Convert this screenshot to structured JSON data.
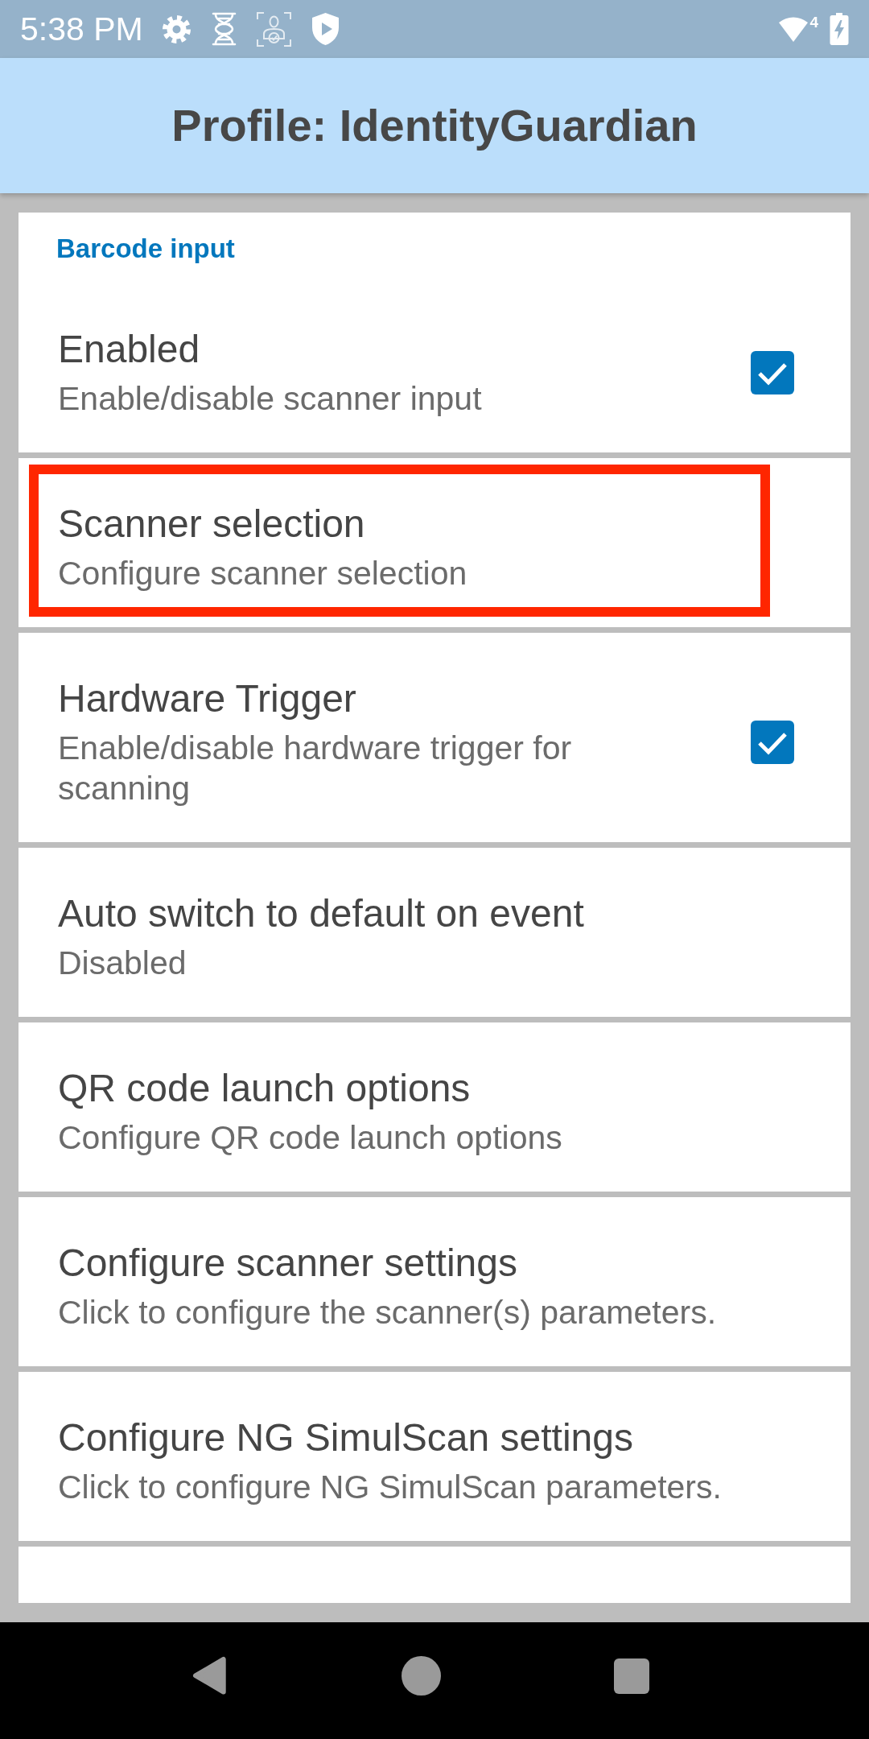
{
  "status_bar": {
    "time": "5:38 PM",
    "network_badge": "4"
  },
  "app_bar": {
    "title": "Profile: IdentityGuardian"
  },
  "section": {
    "title": "Barcode input",
    "items": [
      {
        "kind": "checkbox",
        "title": "Enabled",
        "summary": "Enable/disable scanner input",
        "checked": true,
        "highlighted": false
      },
      {
        "kind": "link",
        "title": "Scanner selection",
        "summary": "Configure scanner selection",
        "highlighted": true
      },
      {
        "kind": "checkbox",
        "title": "Hardware Trigger",
        "summary": "Enable/disable hardware trigger for scanning",
        "checked": true,
        "highlighted": false
      },
      {
        "kind": "link",
        "title": "Auto switch to default on event",
        "summary": "Disabled",
        "highlighted": false
      },
      {
        "kind": "link",
        "title": "QR code launch options",
        "summary": "Configure QR code launch options",
        "highlighted": false
      },
      {
        "kind": "link",
        "title": "Configure scanner settings",
        "summary": "Click to configure the scanner(s) parameters.",
        "highlighted": false
      },
      {
        "kind": "link",
        "title": "Configure NG SimulScan settings",
        "summary": "Click to configure NG SimulScan parameters.",
        "highlighted": false
      }
    ]
  }
}
